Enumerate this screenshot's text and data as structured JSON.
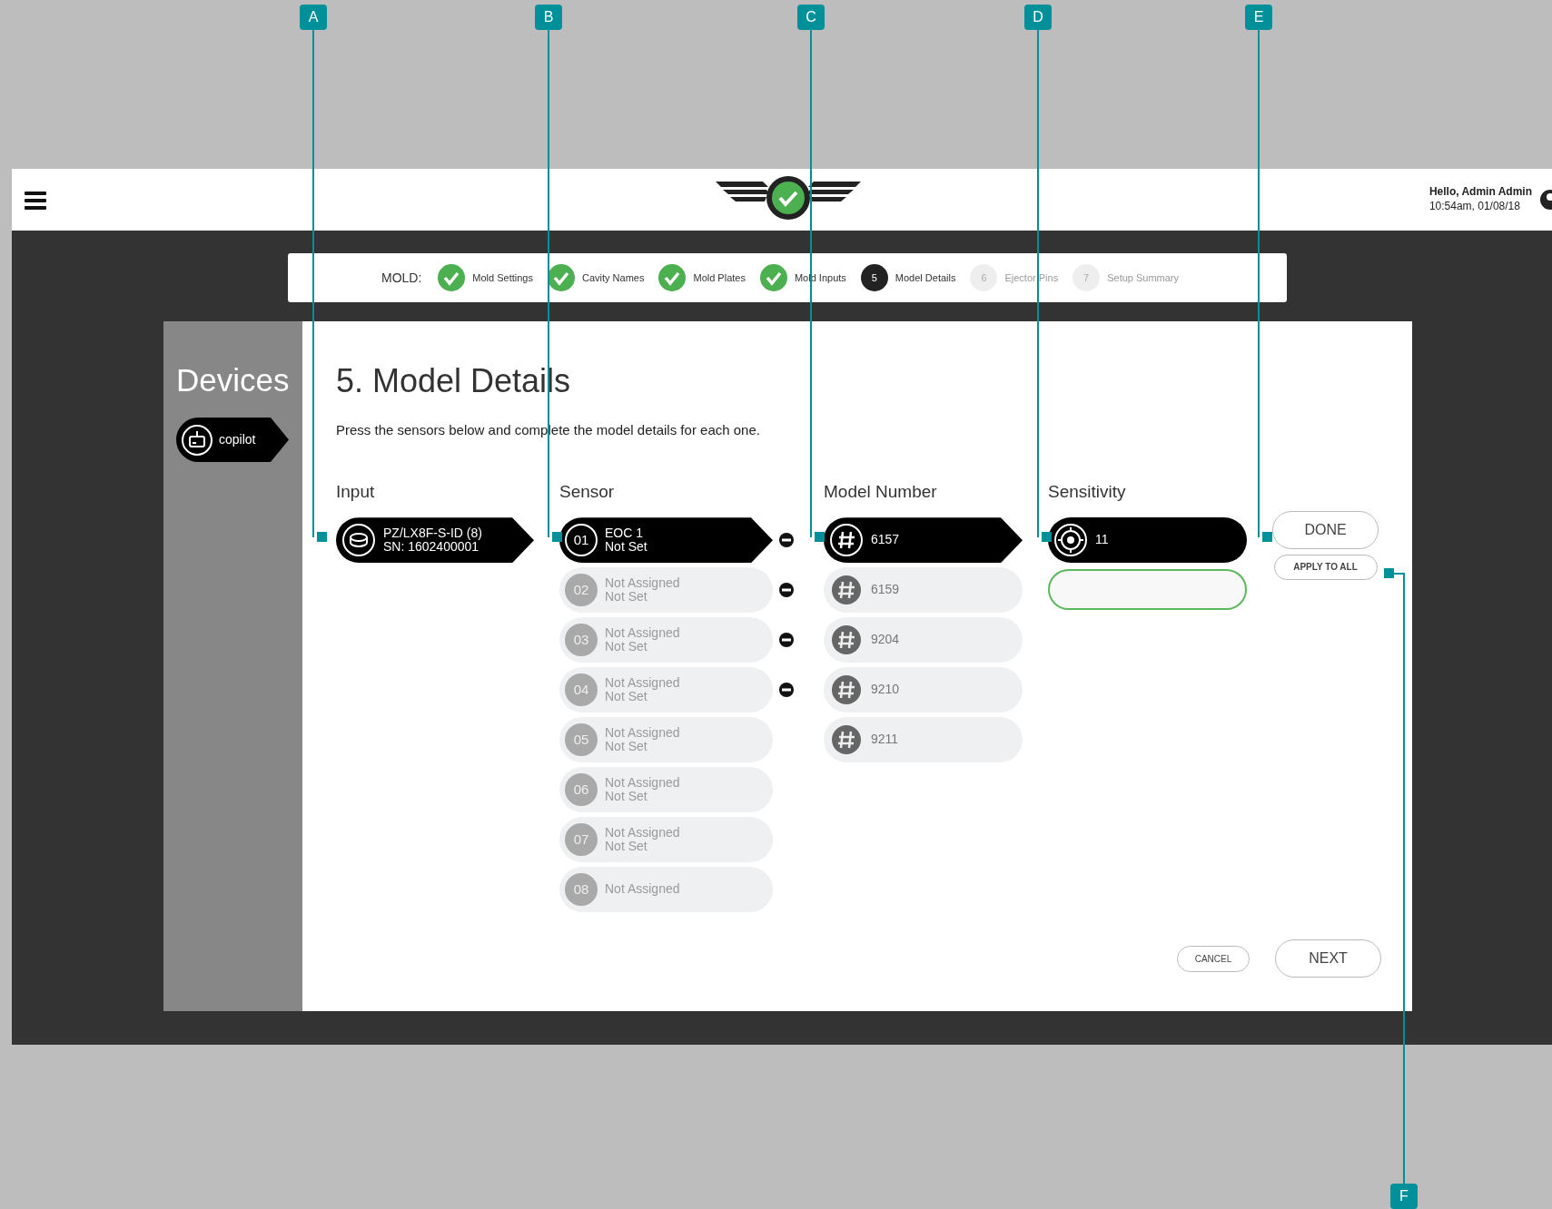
{
  "header": {
    "greeting": "Hello, Admin Admin",
    "datetime": "10:54am, 01/08/18"
  },
  "stepper": {
    "label": "MOLD:",
    "steps": [
      {
        "label": "Mold Settings",
        "done": true,
        "current": false
      },
      {
        "label": "Cavity Names",
        "done": true,
        "current": false
      },
      {
        "label": "Mold Plates",
        "done": true,
        "current": false
      },
      {
        "label": "Mold Inputs",
        "done": true,
        "current": false
      },
      {
        "number": "5",
        "label": "Model Details",
        "done": false,
        "current": true
      },
      {
        "number": "6",
        "label": "Ejector Pins",
        "done": false,
        "current": false
      },
      {
        "number": "7",
        "label": "Setup Summary",
        "done": false,
        "current": false
      }
    ]
  },
  "sidebar": {
    "title": "Devices",
    "items": [
      {
        "label": "copilot",
        "selected": true
      }
    ]
  },
  "page": {
    "title": "5. Model Details",
    "description": "Press the sensors below and complete the model details for each one."
  },
  "columns": [
    "Input",
    "Sensor",
    "Model Number",
    "Sensitivity"
  ],
  "inputs": [
    {
      "name": "PZ/LX8F-S-ID (8)",
      "serial": "SN: 1602400001",
      "selected": true
    }
  ],
  "sensors": [
    {
      "number": "01",
      "name": "EOC 1",
      "status": "Not Set",
      "selected": true,
      "removable": true
    },
    {
      "number": "02",
      "name": "Not Assigned",
      "status": "Not Set",
      "selected": false,
      "removable": true
    },
    {
      "number": "03",
      "name": "Not Assigned",
      "status": "Not Set",
      "selected": false,
      "removable": true
    },
    {
      "number": "04",
      "name": "Not Assigned",
      "status": "Not Set",
      "selected": false,
      "removable": true
    },
    {
      "number": "05",
      "name": "Not Assigned",
      "status": "Not Set",
      "selected": false,
      "removable": false
    },
    {
      "number": "06",
      "name": "Not Assigned",
      "status": "Not Set",
      "selected": false,
      "removable": false
    },
    {
      "number": "07",
      "name": "Not Assigned",
      "status": "Not Set",
      "selected": false,
      "removable": false
    },
    {
      "number": "08",
      "name": "Not Assigned",
      "selected": false,
      "removable": false
    }
  ],
  "models": [
    {
      "number": "6157",
      "selected": true
    },
    {
      "number": "6159",
      "selected": false
    },
    {
      "number": "9204",
      "selected": false
    },
    {
      "number": "9210",
      "selected": false
    },
    {
      "number": "9211",
      "selected": false
    }
  ],
  "sensitivity": {
    "value": "11",
    "field_focused": true
  },
  "buttons": {
    "done": "DONE",
    "apply_all": "APPLY TO ALL",
    "cancel": "CANCEL",
    "next": "NEXT"
  },
  "callouts": [
    {
      "label": "A"
    },
    {
      "label": "B"
    },
    {
      "label": "C"
    },
    {
      "label": "D"
    },
    {
      "label": "E"
    },
    {
      "label": "F"
    }
  ]
}
